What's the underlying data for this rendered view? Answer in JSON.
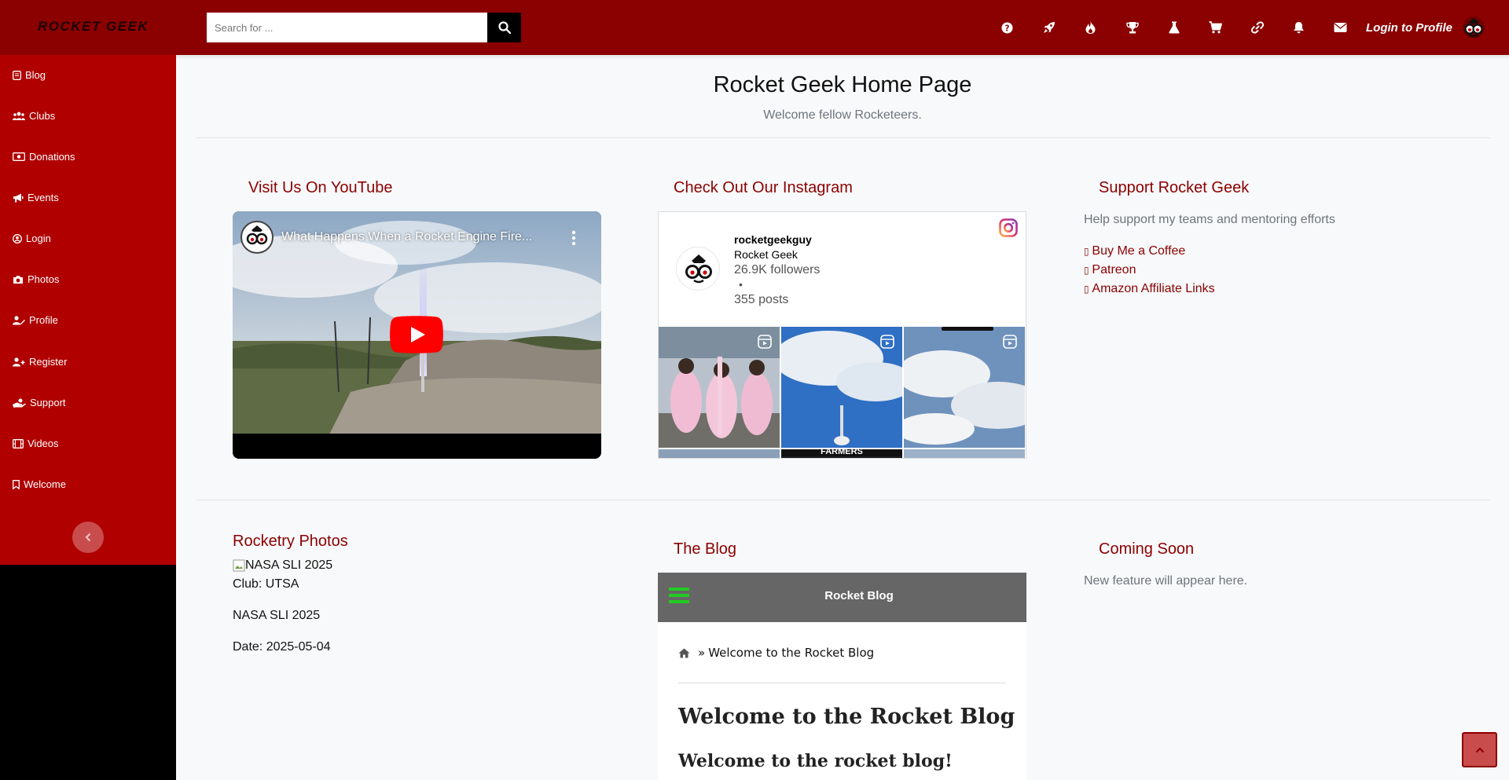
{
  "header": {
    "brand": "ROCKET GEEK",
    "search_placeholder": "Search for ...",
    "login_label": "Login to Profile",
    "icons": [
      "help-icon",
      "rocket-icon",
      "fire-icon",
      "trophy-icon",
      "flask-icon",
      "cart-icon",
      "link-icon",
      "bell-icon",
      "envelope-icon"
    ]
  },
  "sidebar": {
    "items": [
      {
        "label": "Blog",
        "icon": "blog-icon"
      },
      {
        "label": "Clubs",
        "icon": "users-icon"
      },
      {
        "label": "Donations",
        "icon": "money-icon"
      },
      {
        "label": "Events",
        "icon": "bullhorn-icon"
      },
      {
        "label": "Login",
        "icon": "user-circle-icon"
      },
      {
        "label": "Photos",
        "icon": "camera-icon"
      },
      {
        "label": "Profile",
        "icon": "user-edit-icon"
      },
      {
        "label": "Register",
        "icon": "user-plus-icon"
      },
      {
        "label": "Support",
        "icon": "hand-holding-icon"
      },
      {
        "label": "Videos",
        "icon": "film-icon"
      },
      {
        "label": "Welcome",
        "icon": "bookmark-icon"
      }
    ]
  },
  "page": {
    "title": "Rocket Geek Home Page",
    "subtitle": "Welcome fellow Rocketeers."
  },
  "youtube": {
    "heading": "Visit Us On YouTube",
    "video_title": "What Happens When a Rocket Engine Fire..."
  },
  "instagram": {
    "heading": "Check Out Our Instagram",
    "username": "rocketgeekguy",
    "display_name": "Rocket Geek",
    "followers": "26.9K followers",
    "separator": "•",
    "posts": "355 posts",
    "tile_caption": "FARMERS"
  },
  "support": {
    "heading": "Support Rocket Geek",
    "text": "Help support my teams and mentoring efforts",
    "links": [
      "Buy Me a Coffee",
      "Patreon",
      "Amazon Affiliate Links"
    ]
  },
  "photos": {
    "heading": "Rocketry Photos",
    "image_alt": "NASA SLI 2025",
    "club": "Club: UTSA",
    "name": "NASA SLI 2025",
    "date": "Date: 2025-05-04"
  },
  "blog": {
    "heading": "The Blog",
    "card_label": "Rocket Blog",
    "breadcrumb": "Welcome to the Rocket Blog",
    "breadcrumb_sep": "»",
    "h1": "Welcome to the Rocket Blog",
    "h2": "Welcome to the rocket blog!"
  },
  "coming_soon": {
    "heading": "Coming Soon",
    "text": "New feature will appear here."
  },
  "colors": {
    "header_bg": "#8b0000",
    "sidebar_bg": "#b00000",
    "accent_text": "#8b0000",
    "blog_header": "#666666",
    "blog_menu": "#22cc22"
  }
}
